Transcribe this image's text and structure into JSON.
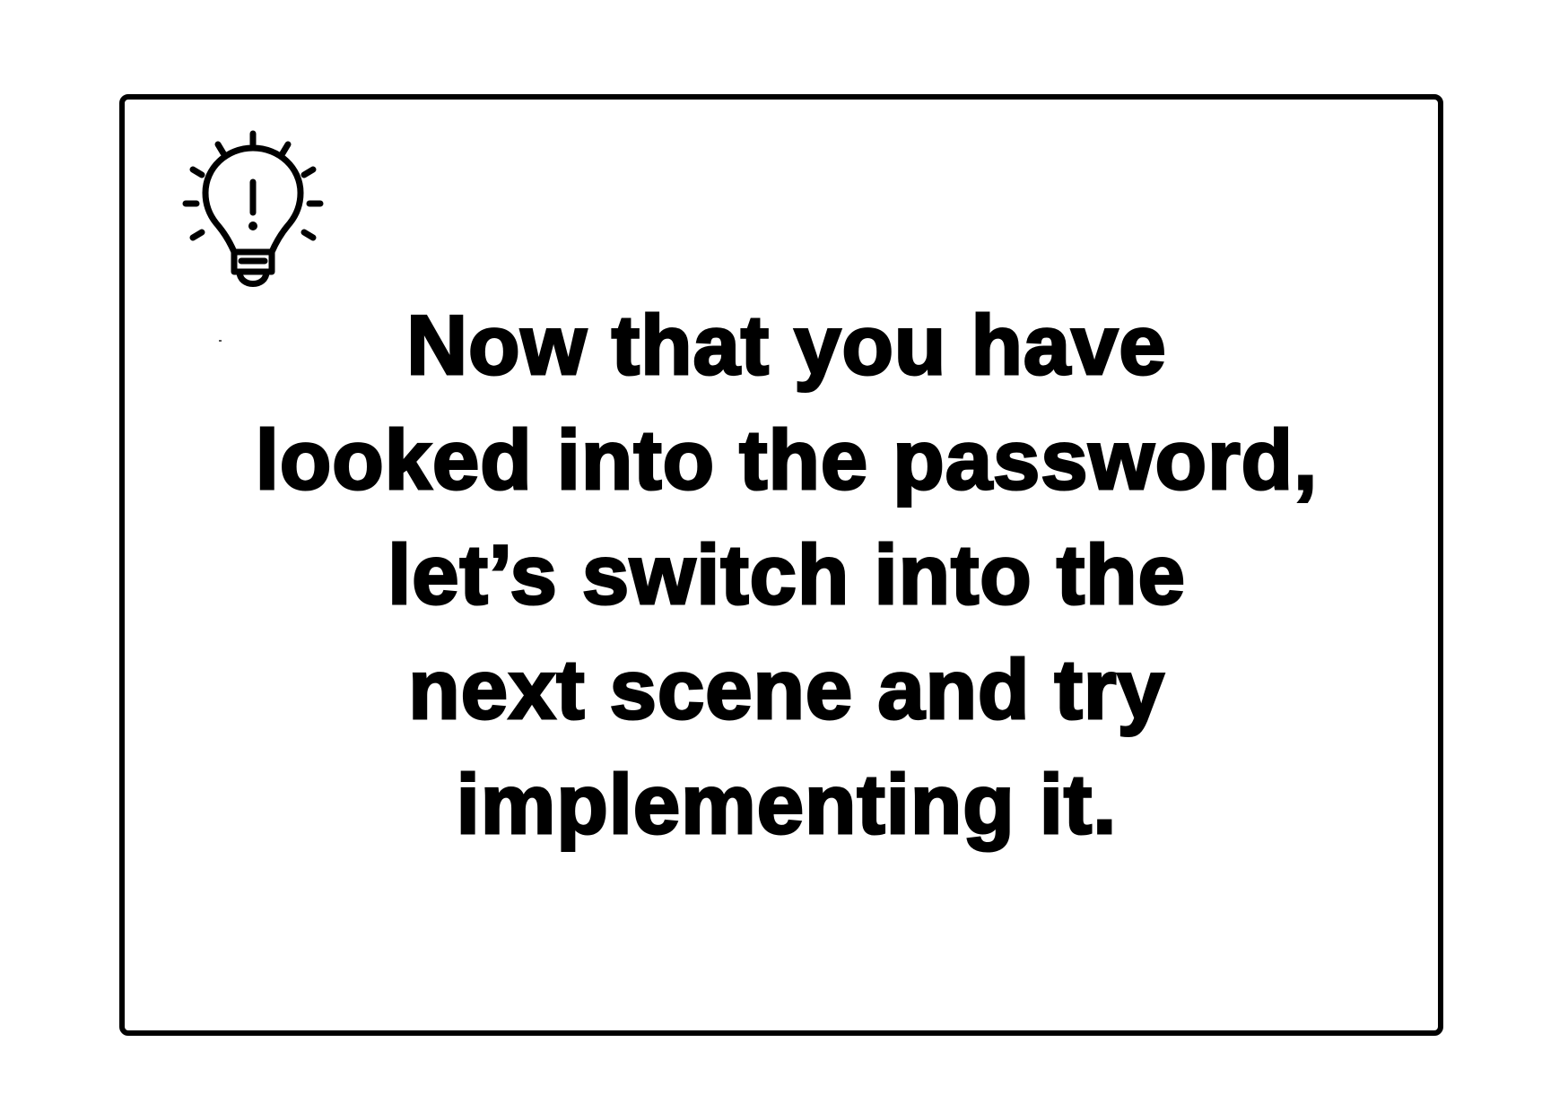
{
  "card": {
    "icon": "lightbulb-idea-icon",
    "message_lines": [
      "Now that you have",
      "looked into the password,",
      "let’s switch into the",
      "next scene and try",
      "implementing it."
    ]
  },
  "colors": {
    "border": "#000000",
    "text": "#000000",
    "background": "#ffffff"
  }
}
